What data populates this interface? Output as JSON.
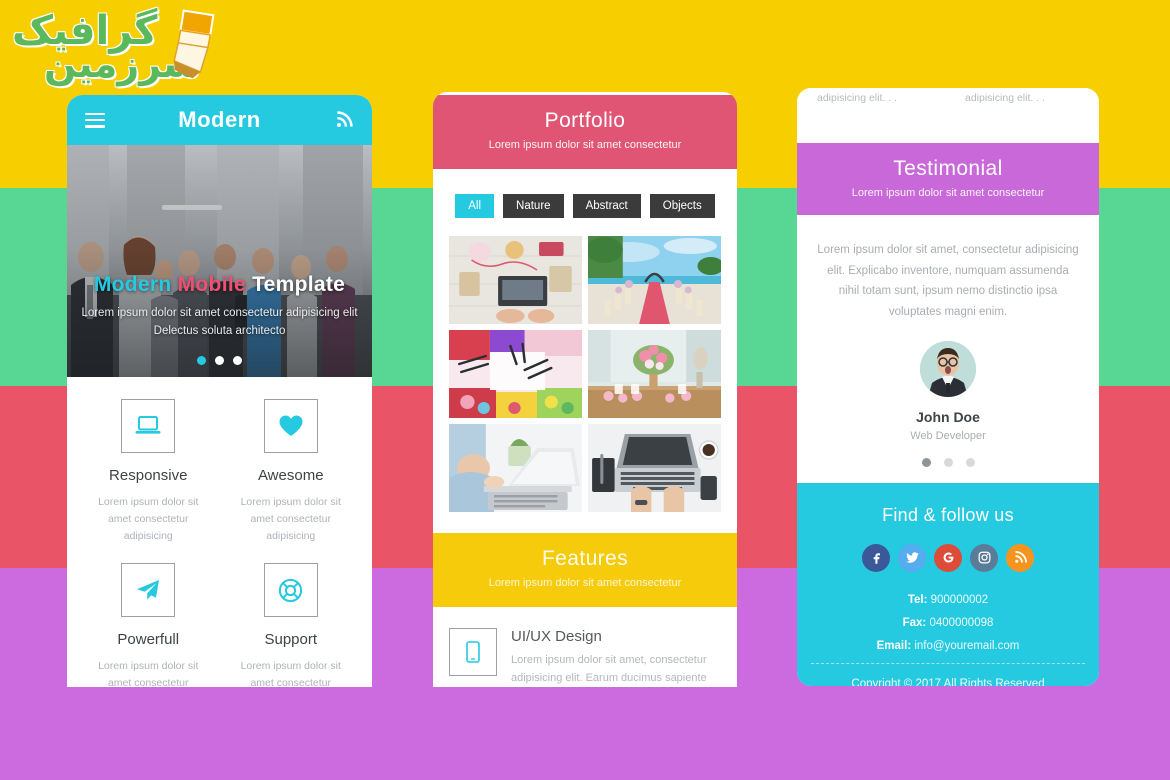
{
  "watermark": {
    "line1": "گرافیک",
    "line2": "سرزمین",
    "icon": "paintbrush-icon"
  },
  "background": {
    "bands": [
      {
        "name": "yellow",
        "color": "#f7cf00"
      },
      {
        "name": "green",
        "color": "#57d694"
      },
      {
        "name": "red",
        "color": "#e95567"
      },
      {
        "name": "purple",
        "color": "#cc6ae0"
      }
    ]
  },
  "phone1": {
    "header": {
      "menu_icon": "hamburger-menu-icon",
      "title": "Modern",
      "rss_icon": "rss-feed-icon"
    },
    "hero": {
      "heading_word1": "Modern",
      "heading_word2": "Mobile",
      "heading_word3": "Template",
      "subtitle_line1": "Lorem ipsum dolor sit amet consectetur adipisicing elit",
      "subtitle_line2": "Delectus soluta architecto",
      "dots": [
        {
          "active": true
        },
        {
          "active": false
        },
        {
          "active": false
        }
      ]
    },
    "features": [
      {
        "icon": "laptop-icon",
        "title": "Responsive",
        "desc": "Lorem ipsum dolor sit amet consectetur adipisicing"
      },
      {
        "icon": "heart-icon",
        "title": "Awesome",
        "desc": "Lorem ipsum dolor sit amet consectetur adipisicing"
      },
      {
        "icon": "paper-plane-icon",
        "title": "Powerfull",
        "desc": "Lorem ipsum dolor sit amet consectetur adipisicing"
      },
      {
        "icon": "lifebuoy-icon",
        "title": "Support",
        "desc": "Lorem ipsum dolor sit amet consectetur adipisicing"
      }
    ]
  },
  "phone2": {
    "portfolio": {
      "title": "Portfolio",
      "subtitle": "Lorem ipsum dolor sit amet consectetur",
      "accent_color": "#e05574",
      "filters": [
        {
          "label": "All",
          "active": true
        },
        {
          "label": "Nature",
          "active": false
        },
        {
          "label": "Abstract",
          "active": false
        },
        {
          "label": "Objects",
          "active": false
        }
      ],
      "thumbnails": [
        {
          "name": "desk-flatlay-stationery"
        },
        {
          "name": "beach-wedding-aisle"
        },
        {
          "name": "art-supplies-brushes"
        },
        {
          "name": "floral-dessert-table"
        },
        {
          "name": "person-working-laptop"
        },
        {
          "name": "laptop-hands-overhead"
        }
      ]
    },
    "features_section": {
      "title": "Features",
      "subtitle": "Lorem ipsum dolor sit amet consectetur",
      "accent_color": "#f6cb0c",
      "items": [
        {
          "icon": "mobile-phone-icon",
          "title": "UI/UX Design",
          "desc": "Lorem ipsum dolor sit amet, consectetur adipisicing elit. Earum ducimus sapiente maiores beatae ipsa dolorem quam"
        }
      ]
    }
  },
  "phone3": {
    "top_fragments": [
      "adipisicing elit. . .",
      "adipisicing elit. . ."
    ],
    "testimonial": {
      "title": "Testimonial",
      "subtitle": "Lorem ipsum dolor sit amet consectetur",
      "accent_color": "#c968d8",
      "quote": "Lorem ipsum dolor sit amet, consectetur adipisicing elit. Explicabo inventore, numquam assumenda nihil totam sunt, ipsum nemo distinctio ipsa voluptates magni enim.",
      "avatar": "man-in-suit-avatar",
      "name": "John Doe",
      "role": "Web Developer",
      "dots": [
        {
          "active": true
        },
        {
          "active": false
        },
        {
          "active": false
        }
      ]
    },
    "footer": {
      "heading": "Find & follow us",
      "accent_color": "#25c9e0",
      "socials": [
        {
          "name": "facebook-icon",
          "color": "#3b5998"
        },
        {
          "name": "twitter-icon",
          "color": "#55acee"
        },
        {
          "name": "google-plus-icon",
          "color": "#dd4b39"
        },
        {
          "name": "instagram-icon",
          "color": "#5b7c99"
        },
        {
          "name": "rss-icon",
          "color": "#f7941d"
        }
      ],
      "tel_label": "Tel:",
      "tel_value": "900000002",
      "fax_label": "Fax:",
      "fax_value": "0400000098",
      "email_label": "Email:",
      "email_value": "info@youremail.com",
      "copyright": "Copyright © 2017 All Rights Reserved"
    }
  }
}
